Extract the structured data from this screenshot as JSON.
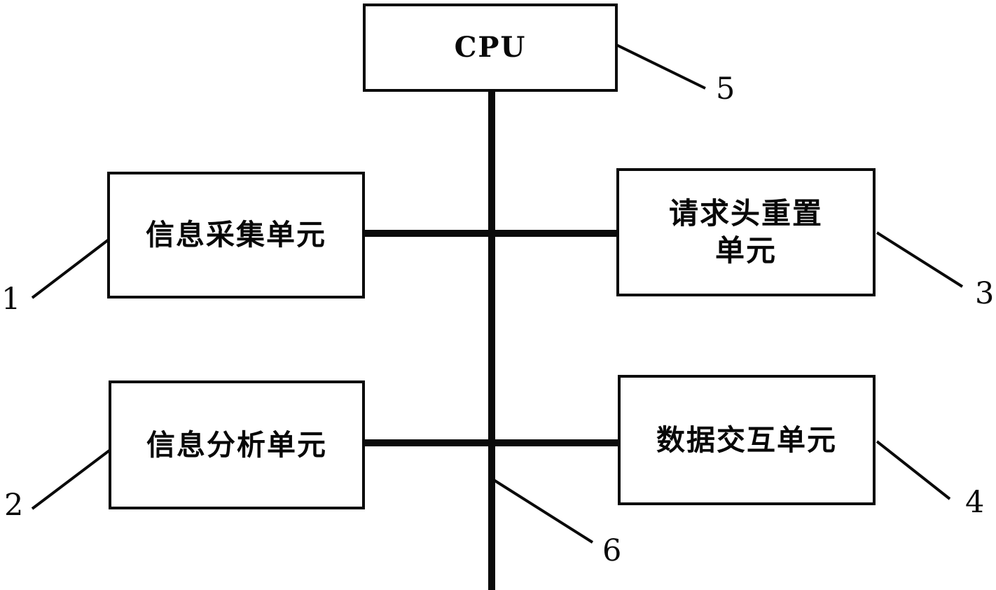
{
  "diagram": {
    "type": "block-diagram",
    "background_color": "#ffffff",
    "line_color": "#0a0a0a",
    "blocks": [
      {
        "id": "cpu",
        "label": "CPU",
        "ref": "5",
        "script": "latin"
      },
      {
        "id": "collect",
        "label": "信息采集单元",
        "ref": "1",
        "script": "cjk"
      },
      {
        "id": "reqreset",
        "label": "请求头重置\n单元",
        "ref": "3",
        "script": "cjk"
      },
      {
        "id": "analyze",
        "label": "信息分析单元",
        "ref": "2",
        "script": "cjk"
      },
      {
        "id": "datax",
        "label": "数据交互单元",
        "ref": "4",
        "script": "cjk"
      }
    ],
    "bus": {
      "ref": "6",
      "description": "central vertical bus with two horizontal branches"
    },
    "reference_numerals": {
      "n1": "1",
      "n2": "2",
      "n3": "3",
      "n4": "4",
      "n5": "5",
      "n6": "6"
    }
  }
}
